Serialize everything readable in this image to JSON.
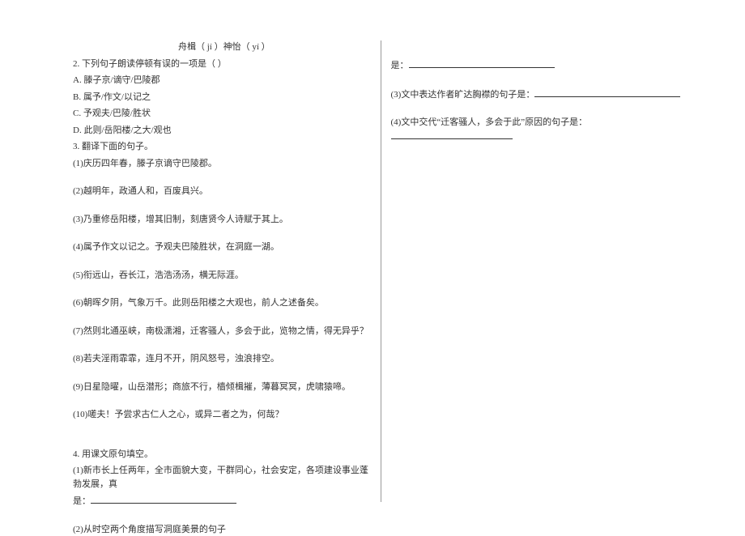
{
  "left": {
    "header_pinyin": "舟楫（   jí  ）神怡（   yí   ）",
    "q2": "2. 下列句子朗读停顿有误的一项是（      ）",
    "q2a": "A. 滕子京/谪守/巴陵郡",
    "q2b": "B. 属予/作文/以记之",
    "q2c": "C. 予观夫/巴陵/胜状",
    "q2d": "D. 此则/岳阳楼/之大/观也",
    "q3": "3. 翻译下面的句子。",
    "q3_1": "(1)庆历四年春，滕子京谪守巴陵郡。",
    "q3_2": "(2)越明年，政通人和，百废具兴。",
    "q3_3": "(3)乃重修岳阳楼，增其旧制，刻唐贤今人诗赋于其上。",
    "q3_4": "(4)属予作文以记之。予观夫巴陵胜状，在洞庭一湖。",
    "q3_5": "(5)衔远山，吞长江，浩浩汤汤，横无际涯。",
    "q3_6": "(6)朝晖夕阴，气象万千。此则岳阳楼之大观也，前人之述备矣。",
    "q3_7": "(7)然则北通巫峡，南极潇湘，迁客骚人，多会于此，览物之情，得无异乎？",
    "q3_8": "(8)若夫淫雨霏霏，连月不开，阴风怒号，浊浪排空。",
    "q3_9": "(9)日星隐曜，山岳潜形；商旅不行，樯倾楫摧，薄暮冥冥，虎啸猿啼。",
    "q3_10": "(10)嗟夫！予尝求古仁人之心，或异二者之为，何哉？",
    "q4": "4. 用课文原句填空。",
    "q4_1": "(1)新市长上任两年，全市面貌大变，干群同心，社会安定，各项建设事业蓬勃发展，真",
    "q4_1b": "是：",
    "q4_2": "(2)从时空两个角度描写洞庭美景的句子"
  },
  "right": {
    "r1": "是：",
    "r3": "(3)文中表达作者旷达胸襟的句子是：",
    "r4": "(4)文中交代“迁客骚人，多会于此”原因的句子是："
  }
}
